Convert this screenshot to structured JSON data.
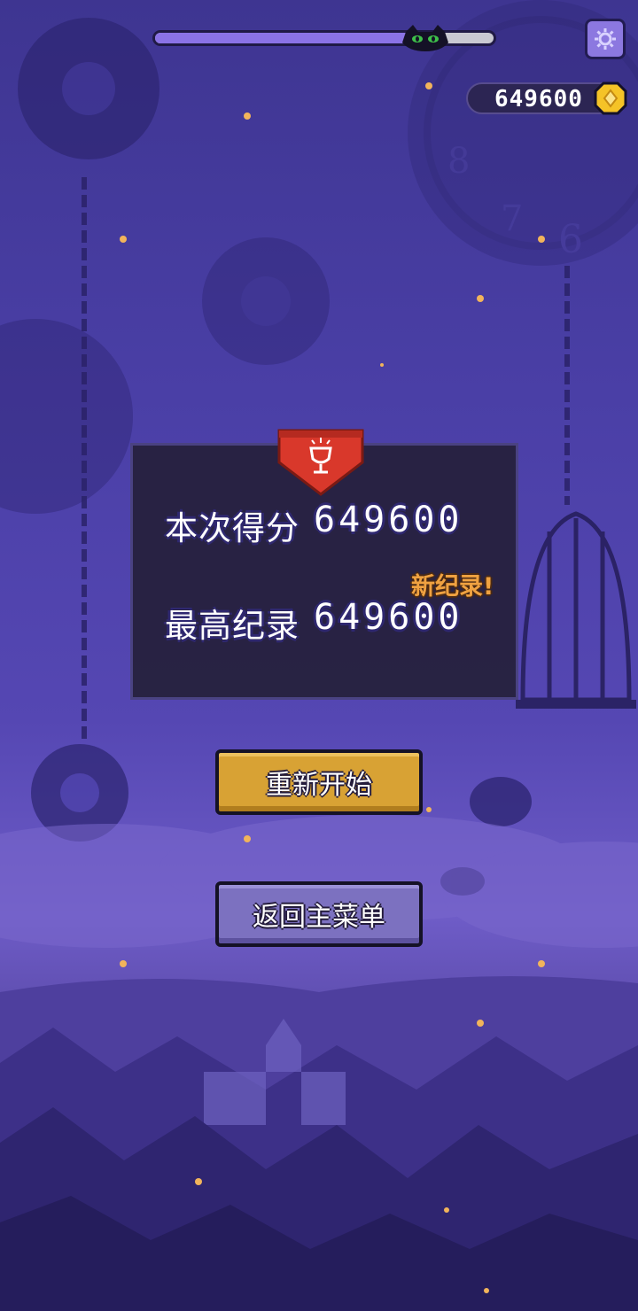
{
  "hud": {
    "level_progress": 0.74,
    "progress_icon": "black-cat-icon",
    "settings_icon": "gear-icon",
    "coins": "649600",
    "coin_icon": "gold-coin-icon"
  },
  "result": {
    "banner_icon": "trophy-icon",
    "score_label": "本次得分",
    "score_value": "649600",
    "best_label": "最高纪录",
    "best_value": "649600",
    "new_record": "新纪录!"
  },
  "buttons": {
    "restart": "重新开始",
    "main_menu": "返回主菜单"
  },
  "colors": {
    "background": "#4a3fa6",
    "panel": "#27223f",
    "restart_button": "#d8a234",
    "menu_button": "#7c71c0",
    "new_record": "#f0a241",
    "banner": "#d9382b"
  }
}
